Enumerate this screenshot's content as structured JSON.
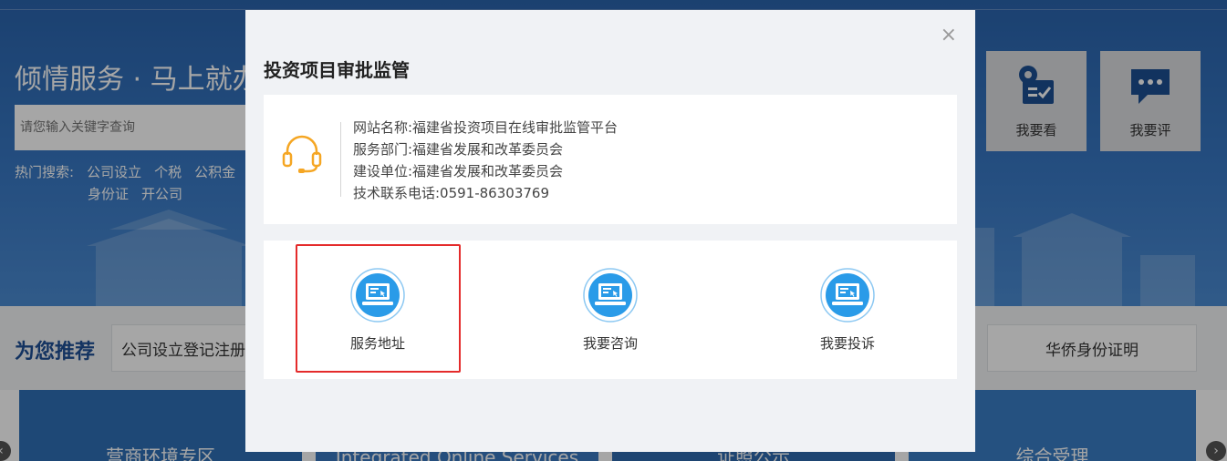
{
  "hero": {
    "title": "倾情服务 · 马上就办",
    "search_placeholder": "请您输入关键字查询",
    "hot_label": "热门搜索:",
    "hot_terms_row1": [
      "公司设立",
      "个税",
      "公积金"
    ],
    "hot_terms_row2": [
      "身份证",
      "开公司"
    ]
  },
  "quick_links": [
    {
      "label": "我要看",
      "icon": "eye-clipboard-icon"
    },
    {
      "label": "我要评",
      "icon": "chat-bubble-icon"
    }
  ],
  "recommend": {
    "title": "为您推荐",
    "chips": [
      "公司设立登记注册",
      "华侨身份证明"
    ]
  },
  "tiles": [
    {
      "label": "营商环境专区",
      "color": "#2f6fb6"
    },
    {
      "label": "Integrated Online Services",
      "color": "#3a79c0"
    },
    {
      "label": "证照公示",
      "color": "#2e6aaf"
    },
    {
      "label": "综合受理",
      "color": "#3a7dc5"
    }
  ],
  "modal": {
    "title": "投资项目审批监管",
    "close_glyph": "×",
    "info": {
      "site_name": "网站名称:福建省投资项目在线审批监管平台",
      "department": "服务部门:福建省发展和改革委员会",
      "builder": "建设单位:福建省发展和改革委员会",
      "phone": "技术联系电话:0591-86303769"
    },
    "actions": [
      {
        "label": "服务地址",
        "icon": "laptop-icon"
      },
      {
        "label": "我要咨询",
        "icon": "laptop-icon"
      },
      {
        "label": "我要投诉",
        "icon": "laptop-icon"
      }
    ]
  },
  "colors": {
    "accent_blue": "#2a9be8",
    "headset_orange": "#f5a623",
    "highlight_red": "#e42b2b",
    "hero_blue": "#2a64ad"
  }
}
